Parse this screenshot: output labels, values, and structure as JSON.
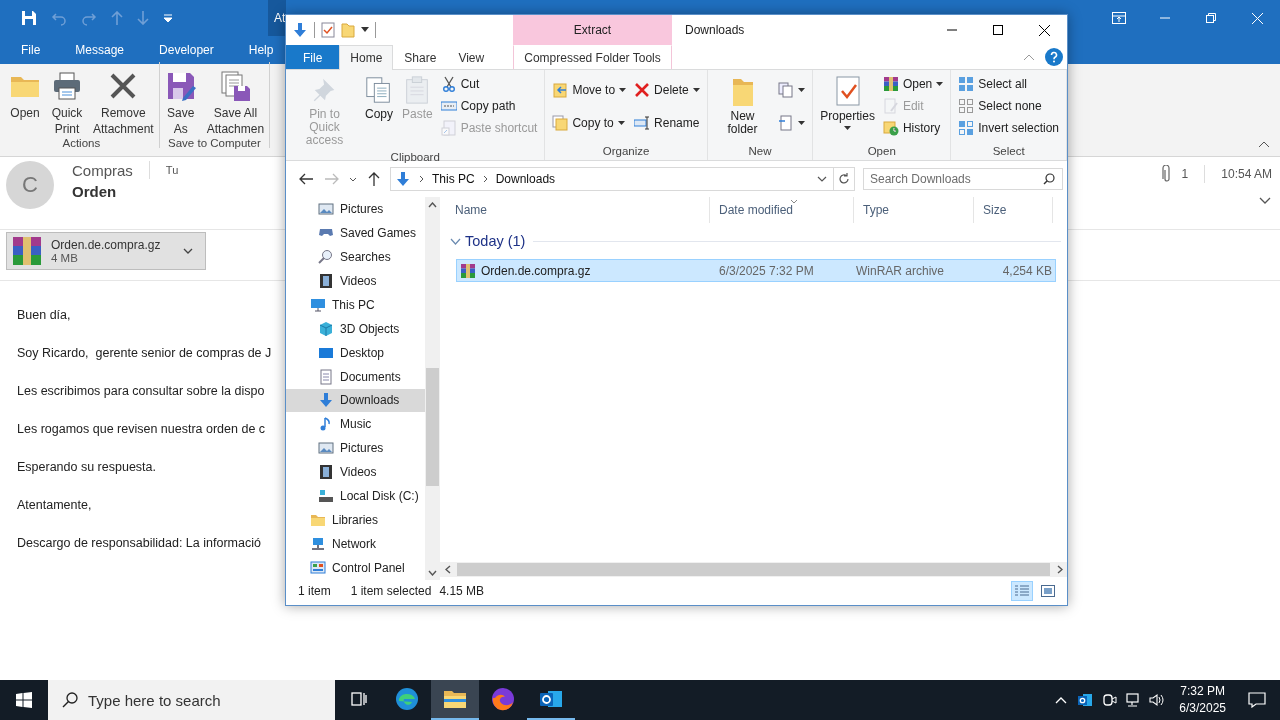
{
  "outlook": {
    "contextual_tab": "At",
    "menu": [
      {
        "label": "File"
      },
      {
        "label": "Message"
      },
      {
        "label": "Developer"
      },
      {
        "label": "Help"
      }
    ],
    "ribbon": [
      {
        "label": "Actions",
        "buttons": [
          "Open",
          "Quick\nPrint",
          "Remove\nAttachment"
        ]
      },
      {
        "label": "Save to Computer",
        "buttons": [
          "Save\nAs",
          "Save All\nAttachmen"
        ]
      }
    ],
    "message": {
      "avatar": "C",
      "sender": "Compras",
      "recipient": "Tu",
      "subject": "Orden",
      "attachment_count": "1",
      "time": "10:54 AM",
      "attachment": {
        "name": "Orden.de.compra.gz",
        "size": "4 MB"
      },
      "body": [
        "Buen día,",
        "Soy Ricardo,  gerente senior de compras de J",
        "Les escribimos para consultar sobre la dispo",
        "Les rogamos que revisen nuestra orden de c",
        "Esperando su respuesta.",
        "Atentamente,",
        "Descargo de responsabilidad: La informació"
      ]
    }
  },
  "explorer": {
    "title": "Downloads",
    "contextual_header": "Extract",
    "tabs": [
      {
        "label": "File",
        "kind": "file",
        "selected": false
      },
      {
        "label": "Home",
        "kind": "tab",
        "selected": true
      },
      {
        "label": "Share",
        "kind": "tab",
        "selected": false
      },
      {
        "label": "View",
        "kind": "tab",
        "selected": false
      },
      {
        "label": "Compressed Folder Tools",
        "kind": "contextual",
        "selected": false
      }
    ],
    "ribbon": [
      {
        "label": "Clipboard",
        "columns": [
          [
            {
              "kind": "large",
              "label": "Pin to Quick access",
              "disabled": true,
              "dropdown": false
            }
          ],
          [
            {
              "kind": "large",
              "label": "Copy",
              "disabled": false,
              "dropdown": false
            }
          ],
          [
            {
              "kind": "large",
              "label": "Paste",
              "disabled": true,
              "dropdown": false
            }
          ],
          [
            {
              "kind": "small",
              "label": "Cut",
              "disabled": false,
              "dropdown": false
            },
            {
              "kind": "small",
              "label": "Copy path",
              "disabled": false,
              "dropdown": false
            },
            {
              "kind": "small",
              "label": "Paste shortcut",
              "disabled": true,
              "dropdown": false
            }
          ]
        ]
      },
      {
        "label": "Organize",
        "columns": [
          [
            {
              "kind": "small",
              "label": "Move to",
              "disabled": false,
              "dropdown": true
            },
            {
              "kind": "small",
              "label": "Copy to",
              "disabled": false,
              "dropdown": true
            }
          ],
          [
            {
              "kind": "small",
              "label": "Delete",
              "disabled": false,
              "dropdown": true
            },
            {
              "kind": "small",
              "label": "Rename",
              "disabled": false,
              "dropdown": false
            }
          ]
        ]
      },
      {
        "label": "New",
        "columns": [
          [
            {
              "kind": "large",
              "label": "New folder",
              "disabled": false,
              "dropdown": false
            }
          ],
          [
            {
              "kind": "icon",
              "disabled": false,
              "dropdown": true
            },
            {
              "kind": "icon",
              "disabled": false,
              "dropdown": true
            }
          ]
        ]
      },
      {
        "label": "Open",
        "columns": [
          [
            {
              "kind": "large",
              "label": "Properties",
              "disabled": false,
              "dropdown": true
            }
          ],
          [
            {
              "kind": "small",
              "label": "Open",
              "disabled": false,
              "dropdown": true
            },
            {
              "kind": "small",
              "label": "Edit",
              "disabled": true,
              "dropdown": false
            },
            {
              "kind": "small",
              "label": "History",
              "disabled": false,
              "dropdown": false
            }
          ]
        ]
      },
      {
        "label": "Select",
        "columns": [
          [
            {
              "kind": "small",
              "label": "Select all",
              "disabled": false,
              "dropdown": false
            },
            {
              "kind": "small",
              "label": "Select none",
              "disabled": false,
              "dropdown": false
            },
            {
              "kind": "small",
              "label": "Invert selection",
              "disabled": false,
              "dropdown": false
            }
          ]
        ]
      }
    ],
    "address": {
      "path": [
        "This PC",
        "Downloads"
      ]
    },
    "search": {
      "placeholder": "Search Downloads"
    },
    "nav_tree": [
      {
        "children": [
          {
            "label": "Pictures",
            "selected": false
          },
          {
            "label": "Saved Games",
            "selected": false
          },
          {
            "label": "Searches",
            "selected": false
          },
          {
            "label": "Videos",
            "selected": false
          }
        ]
      },
      {
        "label": "This PC",
        "selected": false,
        "children": [
          {
            "label": "3D Objects",
            "selected": false
          },
          {
            "label": "Desktop",
            "selected": false
          },
          {
            "label": "Documents",
            "selected": false
          },
          {
            "label": "Downloads",
            "selected": true
          },
          {
            "label": "Music",
            "selected": false
          },
          {
            "label": "Pictures",
            "selected": false
          },
          {
            "label": "Videos",
            "selected": false
          },
          {
            "label": "Local Disk (C:)",
            "selected": false
          }
        ]
      },
      {
        "label": "Libraries",
        "selected": false
      },
      {
        "label": "Network",
        "selected": false
      },
      {
        "label": "Control Panel",
        "selected": false
      }
    ],
    "columns": [
      "Name",
      "Date modified",
      "Type",
      "Size"
    ],
    "groups": [
      {
        "label": "Today (1)",
        "expanded": true,
        "files": [
          {
            "name": "Orden.de.compra.gz",
            "date": "6/3/2025 7:32 PM",
            "type": "WinRAR archive",
            "size": "4,254 KB",
            "selected": true
          }
        ]
      }
    ],
    "status": {
      "count": "1 item",
      "selection": "1 item selected",
      "size": "4.15 MB"
    },
    "views": [
      {
        "selected": true
      },
      {
        "selected": false
      }
    ]
  },
  "taskbar": {
    "search": {
      "placeholder": "Type here to search"
    },
    "apps": [
      {
        "active": false,
        "running": false
      },
      {
        "active": false,
        "running": false
      },
      {
        "active": true,
        "running": true
      },
      {
        "active": false,
        "running": false
      },
      {
        "active": false,
        "running": true
      }
    ],
    "time": "7:32 PM",
    "date": "6/3/2025"
  }
}
